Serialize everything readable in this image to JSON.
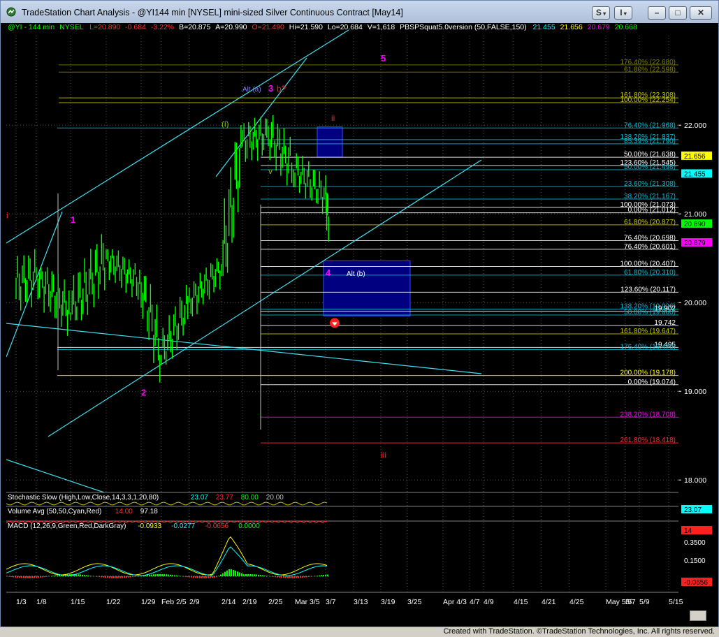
{
  "window": {
    "title": "TradeStation Chart Analysis - @YI144 min [NYSEL] mini-sized Silver Continuous Contract [May14]",
    "buttons": [
      "S",
      "I",
      "–",
      "□",
      "✕"
    ]
  },
  "header": {
    "symbol": "@YI - 144 min",
    "exchange": "NYSEL",
    "last": "L=20.890",
    "change": "-0.684",
    "change_pct": "-3.22%",
    "bid": "B=20.875",
    "ask": "A=20.990",
    "open": "O=21.490",
    "high": "Hi=21.590",
    "low": "Lo=20.684",
    "volume": "V=1,618",
    "indicator": "PBSPSquat5.0version (50,FALSE,150)",
    "ind_values": [
      "21.455",
      "21.656",
      "20.679",
      "20.668"
    ]
  },
  "chart_data": {
    "type": "candlestick",
    "symbol": "@YI",
    "interval": "144 min",
    "x_tick_labels": [
      "1/3",
      "1/8",
      "1/15",
      "1/22",
      "1/29",
      "Feb 2/5",
      "2/9",
      "2/14",
      "2/19",
      "2/25",
      "Mar 3/5",
      "3/7",
      "3/13",
      "3/19",
      "3/25",
      "Apr 4/3",
      "4/7",
      "4/9",
      "4/15",
      "4/21",
      "4/25",
      "May 5/5",
      "5/7",
      "5/9",
      "5/15"
    ],
    "y_axis_ticks": [
      "22.000",
      "21.000",
      "20.000",
      "19.000",
      "18.000"
    ],
    "ylim": [
      17.8,
      22.6
    ],
    "price_badges": [
      {
        "value": "21.656",
        "color": "#ffff00"
      },
      {
        "value": "21.455",
        "color": "#00ffff"
      },
      {
        "value": "20.890",
        "color": "#00ff00"
      },
      {
        "value": "20.679",
        "color": "#ff00ff"
      }
    ],
    "fib_levels": [
      {
        "label": "176.40% (22.680)",
        "value": 22.68,
        "color": "#808000"
      },
      {
        "label": "61.80% (22.598)",
        "value": 22.598,
        "color": "#808000"
      },
      {
        "label": "161.80% (22.308)",
        "value": 22.308,
        "color": "#c8c800"
      },
      {
        "label": "100.00% (22.254)",
        "value": 22.254,
        "color": "#c8c800"
      },
      {
        "label": "76.40% (21.968)",
        "value": 21.968,
        "color": "#00bcd4"
      },
      {
        "label": "138.20% (21.837)",
        "value": 21.837,
        "color": "#00bcd4"
      },
      {
        "label": "85.39% (21.790)",
        "value": 21.79,
        "color": "#00bcd4"
      },
      {
        "label": "50.00% (21.638)",
        "value": 21.638,
        "color": "#ffffff"
      },
      {
        "label": "123.60% (21.545)",
        "value": 21.545,
        "color": "#ffffff"
      },
      {
        "label": "50.00% (21.498)",
        "value": 21.498,
        "color": "#00bcd4"
      },
      {
        "label": "23.60% (21.308)",
        "value": 21.308,
        "color": "#00bcd4"
      },
      {
        "label": "38.20% (21.167)",
        "value": 21.167,
        "color": "#00bcd4"
      },
      {
        "label": "100.00% (21.073)",
        "value": 21.073,
        "color": "#ffffff"
      },
      {
        "label": "0.00% (21.012)",
        "value": 21.012,
        "color": "#ffffff"
      },
      {
        "label": "61.80% (20.877)",
        "value": 20.877,
        "color": "#c8c800"
      },
      {
        "label": "76.40% (20.698)",
        "value": 20.698,
        "color": "#ffffff"
      },
      {
        "label": "76.40% (20.601)",
        "value": 20.601,
        "color": "#ffffff"
      },
      {
        "label": "100.00% (20.407)",
        "value": 20.407,
        "color": "#ffffff"
      },
      {
        "label": "61.80% (20.310)",
        "value": 20.31,
        "color": "#00bcd4"
      },
      {
        "label": "123.60% (20.117)",
        "value": 20.117,
        "color": "#ffffff"
      },
      {
        "label": "138.20% (19.926)",
        "value": 19.926,
        "color": "#00bcd4"
      },
      {
        "label": "19.902",
        "value": 19.902,
        "color": "#ffffff"
      },
      {
        "label": "50.00% (19.860)",
        "value": 19.86,
        "color": "#00bcd4"
      },
      {
        "label": "19.742",
        "value": 19.742,
        "color": "#ffffff"
      },
      {
        "label": "161.80% (19.647)",
        "value": 19.647,
        "color": "#c8c800"
      },
      {
        "label": "19.495",
        "value": 19.495,
        "color": "#ffffff"
      },
      {
        "label": "176.40% (19.470)",
        "value": 19.47,
        "color": "#00bcd4"
      },
      {
        "label": "200.00% (19.178)",
        "value": 19.178,
        "color": "#ffff00"
      },
      {
        "label": "0.00% (19.074)",
        "value": 19.074,
        "color": "#ffffff"
      },
      {
        "label": "238.20% (18.708)",
        "value": 18.708,
        "color": "#ff00ff"
      },
      {
        "label": "261.80% (18.418)",
        "value": 18.418,
        "color": "#ff3030"
      }
    ],
    "wave_labels": [
      {
        "text": "1",
        "color": "#ff00ff",
        "x": "1/15",
        "price": 20.9
      },
      {
        "text": "2",
        "color": "#ff00ff",
        "x": "1/29",
        "price": 18.95
      },
      {
        "text": "3",
        "color": "#ff00ff",
        "x": "2/25",
        "price": 22.38
      },
      {
        "text": "4",
        "color": "#ff00ff",
        "x": "3/7",
        "price": 20.3
      },
      {
        "text": "5",
        "color": "#ff00ff",
        "x": "3/19",
        "price": 22.72
      },
      {
        "text": "Alt (a)",
        "color": "#8080ff",
        "x": "2/19",
        "price": 22.38
      },
      {
        "text": "b?",
        "color": "#ff2020",
        "x": "2/25",
        "price": 22.38
      },
      {
        "text": "ii",
        "color": "#ff2020",
        "x": "3/7",
        "price": 22.05
      },
      {
        "text": "i",
        "color": "#ff2020",
        "x": "3/5",
        "price": 20.95
      },
      {
        "text": "iii",
        "color": "#ff2020",
        "x": "3/19",
        "price": 18.25
      },
      {
        "text": "Alt (b)",
        "color": "#ffffff",
        "x": "3/7",
        "price": 20.3
      },
      {
        "text": "v",
        "color": "#80c000",
        "x": "2/25",
        "price": 21.45
      },
      {
        "text": "(i)",
        "color": "#80c000",
        "x": "2/14",
        "price": 21.98
      }
    ],
    "price_series": [
      {
        "x": "1/3",
        "o": 20.2,
        "h": 20.7,
        "l": 19.7,
        "c": 20.3
      },
      {
        "x": "1/8",
        "o": 20.3,
        "h": 20.4,
        "l": 19.45,
        "c": 19.9
      },
      {
        "x": "1/15",
        "o": 19.9,
        "h": 20.9,
        "l": 19.8,
        "c": 20.5
      },
      {
        "x": "1/22",
        "o": 20.5,
        "h": 20.6,
        "l": 19.9,
        "c": 20.2
      },
      {
        "x": "1/29",
        "o": 20.2,
        "h": 20.3,
        "l": 19.1,
        "c": 19.4
      },
      {
        "x": "Feb 2/5",
        "o": 19.4,
        "h": 20.2,
        "l": 19.3,
        "c": 20.0
      },
      {
        "x": "2/9",
        "o": 20.0,
        "h": 20.5,
        "l": 19.8,
        "c": 20.4
      },
      {
        "x": "2/14",
        "o": 20.4,
        "h": 22.0,
        "l": 20.3,
        "c": 21.8
      },
      {
        "x": "2/19",
        "o": 21.8,
        "h": 22.2,
        "l": 21.4,
        "c": 21.9
      },
      {
        "x": "2/25",
        "o": 21.9,
        "h": 22.25,
        "l": 21.3,
        "c": 21.5
      },
      {
        "x": "Mar 3/5",
        "o": 21.5,
        "h": 21.7,
        "l": 21.0,
        "c": 21.2
      },
      {
        "x": "3/7",
        "o": 21.2,
        "h": 21.59,
        "l": 20.68,
        "c": 20.89
      }
    ],
    "indicators": [
      {
        "name": "Stochastic Slow (High,Low,Close,14,3,3,1,20,80)",
        "values": [
          "23.07",
          "23.77",
          "80.00",
          "20.00"
        ],
        "badge": "23.07"
      },
      {
        "name": "Volume Avg (50,50,Cyan,Red)",
        "values": [
          "14.00",
          "97.18"
        ],
        "badge": "14"
      },
      {
        "name": "MACD (12,26,9,Green,Red,DarkGray)",
        "values": [
          "-0.0933",
          "-0.0277",
          "-0.0656",
          "0.0000"
        ],
        "badge": "-0.0656",
        "axis": [
          "0.3500",
          "0.1500"
        ]
      }
    ]
  },
  "colors": {
    "background": "#000000",
    "candles": "#00ff00",
    "trendlines": "#40e0f0",
    "box_fill": "#000080",
    "box_border": "#0070ff",
    "magenta": "#ff00ff",
    "red": "#ff2020"
  },
  "footer": "Created with TradeStation. ©TradeStation Technologies, Inc. All rights reserved."
}
